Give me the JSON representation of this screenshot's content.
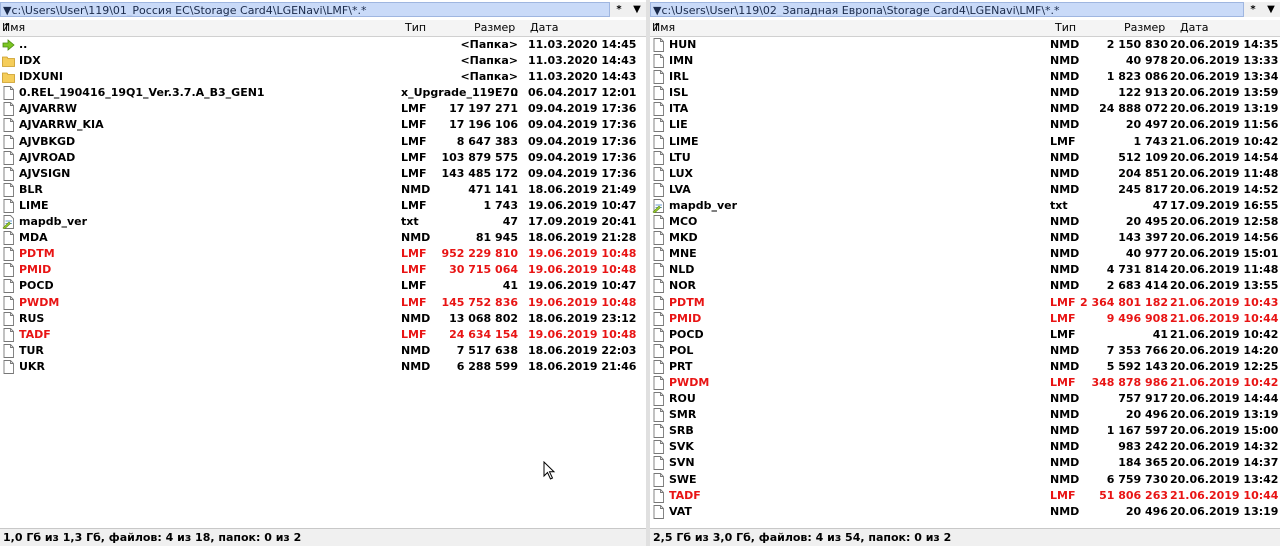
{
  "left": {
    "path": "c:\\Users\\User\\119\\01_Россия EC\\Storage Card4\\LGENavi\\LMF\\*.*",
    "star": "*",
    "arrow": "▼",
    "headers": {
      "name": "Имя",
      "type": "Тип",
      "size": "Размер",
      "date": "Дата"
    },
    "rows": [
      {
        "icon": "up",
        "name": "..",
        "type": "",
        "size": "<Папка>",
        "date": "11.03.2020 14:45",
        "red": false
      },
      {
        "icon": "folder",
        "name": "IDX",
        "type": "",
        "size": "<Папка>",
        "date": "11.03.2020 14:43",
        "red": false
      },
      {
        "icon": "folder",
        "name": "IDXUNI",
        "type": "",
        "size": "<Папка>",
        "date": "11.03.2020 14:43",
        "red": false
      },
      {
        "icon": "file",
        "name": "0.REL_190416_19Q1_Ver.3.7.A_B3_GEN1",
        "type": "x_Upgrade_119E7..",
        "size": "0",
        "date": "06.04.2017 12:01",
        "red": false
      },
      {
        "icon": "file",
        "name": "AJVARRW",
        "type": "LMF",
        "size": "17 197 271",
        "date": "09.04.2019 17:36",
        "red": false
      },
      {
        "icon": "file",
        "name": "AJVARRW_KIA",
        "type": "LMF",
        "size": "17 196 106",
        "date": "09.04.2019 17:36",
        "red": false
      },
      {
        "icon": "file",
        "name": "AJVBKGD",
        "type": "LMF",
        "size": "8 647 383",
        "date": "09.04.2019 17:36",
        "red": false
      },
      {
        "icon": "file",
        "name": "AJVROAD",
        "type": "LMF",
        "size": "103 879 575",
        "date": "09.04.2019 17:36",
        "red": false
      },
      {
        "icon": "file",
        "name": "AJVSIGN",
        "type": "LMF",
        "size": "143 485 172",
        "date": "09.04.2019 17:36",
        "red": false
      },
      {
        "icon": "file",
        "name": "BLR",
        "type": "NMD",
        "size": "471 141",
        "date": "18.06.2019 21:49",
        "red": false
      },
      {
        "icon": "file",
        "name": "LIME",
        "type": "LMF",
        "size": "1 743",
        "date": "19.06.2019 10:47",
        "red": false
      },
      {
        "icon": "txt",
        "name": "mapdb_ver",
        "type": "txt",
        "size": "47",
        "date": "17.09.2019 20:41",
        "red": false
      },
      {
        "icon": "file",
        "name": "MDA",
        "type": "NMD",
        "size": "81 945",
        "date": "18.06.2019 21:28",
        "red": false
      },
      {
        "icon": "file",
        "name": "PDTM",
        "type": "LMF",
        "size": "952 229 810",
        "date": "19.06.2019 10:48",
        "red": true
      },
      {
        "icon": "file",
        "name": "PMID",
        "type": "LMF",
        "size": "30 715 064",
        "date": "19.06.2019 10:48",
        "red": true
      },
      {
        "icon": "file",
        "name": "POCD",
        "type": "LMF",
        "size": "41",
        "date": "19.06.2019 10:47",
        "red": false
      },
      {
        "icon": "file",
        "name": "PWDM",
        "type": "LMF",
        "size": "145 752 836",
        "date": "19.06.2019 10:48",
        "red": true
      },
      {
        "icon": "file",
        "name": "RUS",
        "type": "NMD",
        "size": "13 068 802",
        "date": "18.06.2019 23:12",
        "red": false
      },
      {
        "icon": "file",
        "name": "TADF",
        "type": "LMF",
        "size": "24 634 154",
        "date": "19.06.2019 10:48",
        "red": true
      },
      {
        "icon": "file",
        "name": "TUR",
        "type": "NMD",
        "size": "7 517 638",
        "date": "18.06.2019 22:03",
        "red": false
      },
      {
        "icon": "file",
        "name": "UKR",
        "type": "NMD",
        "size": "6 288 599",
        "date": "18.06.2019 21:46",
        "red": false
      }
    ],
    "status": "1,0 Гб из 1,3 Гб, файлов: 4 из 18, папок: 0 из 2"
  },
  "right": {
    "path": "c:\\Users\\User\\119\\02_Западная Европа\\Storage Card4\\LGENavi\\LMF\\*.*",
    "star": "*",
    "arrow": "▼",
    "headers": {
      "name": "Имя",
      "type": "Тип",
      "size": "Размер",
      "date": "Дата"
    },
    "rows": [
      {
        "icon": "file",
        "name": "HUN",
        "type": "NMD",
        "size": "2 150 830",
        "date": "20.06.2019 14:35",
        "red": false
      },
      {
        "icon": "file",
        "name": "IMN",
        "type": "NMD",
        "size": "40 978",
        "date": "20.06.2019 13:33",
        "red": false
      },
      {
        "icon": "file",
        "name": "IRL",
        "type": "NMD",
        "size": "1 823 086",
        "date": "20.06.2019 13:34",
        "red": false
      },
      {
        "icon": "file",
        "name": "ISL",
        "type": "NMD",
        "size": "122 913",
        "date": "20.06.2019 13:59",
        "red": false
      },
      {
        "icon": "file",
        "name": "ITA",
        "type": "NMD",
        "size": "24 888 072",
        "date": "20.06.2019 13:19",
        "red": false
      },
      {
        "icon": "file",
        "name": "LIE",
        "type": "NMD",
        "size": "20 497",
        "date": "20.06.2019 11:56",
        "red": false
      },
      {
        "icon": "file",
        "name": "LIME",
        "type": "LMF",
        "size": "1 743",
        "date": "21.06.2019 10:42",
        "red": false
      },
      {
        "icon": "file",
        "name": "LTU",
        "type": "NMD",
        "size": "512 109",
        "date": "20.06.2019 14:54",
        "red": false
      },
      {
        "icon": "file",
        "name": "LUX",
        "type": "NMD",
        "size": "204 851",
        "date": "20.06.2019 11:48",
        "red": false
      },
      {
        "icon": "file",
        "name": "LVA",
        "type": "NMD",
        "size": "245 817",
        "date": "20.06.2019 14:52",
        "red": false
      },
      {
        "icon": "txt",
        "name": "mapdb_ver",
        "type": "txt",
        "size": "47",
        "date": "17.09.2019 16:55",
        "red": false
      },
      {
        "icon": "file",
        "name": "MCO",
        "type": "NMD",
        "size": "20 495",
        "date": "20.06.2019 12:58",
        "red": false
      },
      {
        "icon": "file",
        "name": "MKD",
        "type": "NMD",
        "size": "143 397",
        "date": "20.06.2019 14:56",
        "red": false
      },
      {
        "icon": "file",
        "name": "MNE",
        "type": "NMD",
        "size": "40 977",
        "date": "20.06.2019 15:01",
        "red": false
      },
      {
        "icon": "file",
        "name": "NLD",
        "type": "NMD",
        "size": "4 731 814",
        "date": "20.06.2019 11:48",
        "red": false
      },
      {
        "icon": "file",
        "name": "NOR",
        "type": "NMD",
        "size": "2 683 414",
        "date": "20.06.2019 13:55",
        "red": false
      },
      {
        "icon": "file",
        "name": "PDTM",
        "type": "LMF",
        "size": "2 364 801 182",
        "date": "21.06.2019 10:43",
        "red": true
      },
      {
        "icon": "file",
        "name": "PMID",
        "type": "LMF",
        "size": "9 496 908",
        "date": "21.06.2019 10:44",
        "red": true
      },
      {
        "icon": "file",
        "name": "POCD",
        "type": "LMF",
        "size": "41",
        "date": "21.06.2019 10:42",
        "red": false
      },
      {
        "icon": "file",
        "name": "POL",
        "type": "NMD",
        "size": "7 353 766",
        "date": "20.06.2019 14:20",
        "red": false
      },
      {
        "icon": "file",
        "name": "PRT",
        "type": "NMD",
        "size": "5 592 143",
        "date": "20.06.2019 12:25",
        "red": false
      },
      {
        "icon": "file",
        "name": "PWDM",
        "type": "LMF",
        "size": "348 878 986",
        "date": "21.06.2019 10:42",
        "red": true
      },
      {
        "icon": "file",
        "name": "ROU",
        "type": "NMD",
        "size": "757 917",
        "date": "20.06.2019 14:44",
        "red": false
      },
      {
        "icon": "file",
        "name": "SMR",
        "type": "NMD",
        "size": "20 496",
        "date": "20.06.2019 13:19",
        "red": false
      },
      {
        "icon": "file",
        "name": "SRB",
        "type": "NMD",
        "size": "1 167 597",
        "date": "20.06.2019 15:00",
        "red": false
      },
      {
        "icon": "file",
        "name": "SVK",
        "type": "NMD",
        "size": "983 242",
        "date": "20.06.2019 14:32",
        "red": false
      },
      {
        "icon": "file",
        "name": "SVN",
        "type": "NMD",
        "size": "184 365",
        "date": "20.06.2019 14:37",
        "red": false
      },
      {
        "icon": "file",
        "name": "SWE",
        "type": "NMD",
        "size": "6 759 730",
        "date": "20.06.2019 13:42",
        "red": false
      },
      {
        "icon": "file",
        "name": "TADF",
        "type": "LMF",
        "size": "51 806 263",
        "date": "21.06.2019 10:44",
        "red": true
      },
      {
        "icon": "file",
        "name": "VAT",
        "type": "NMD",
        "size": "20 496",
        "date": "20.06.2019 13:19",
        "red": false
      }
    ],
    "status": "2,5 Гб из 3,0 Гб, файлов: 4 из 54, папок: 0 из 2"
  },
  "colors": {
    "highlight": "#e81414",
    "pathbar": "#c9daf8"
  }
}
